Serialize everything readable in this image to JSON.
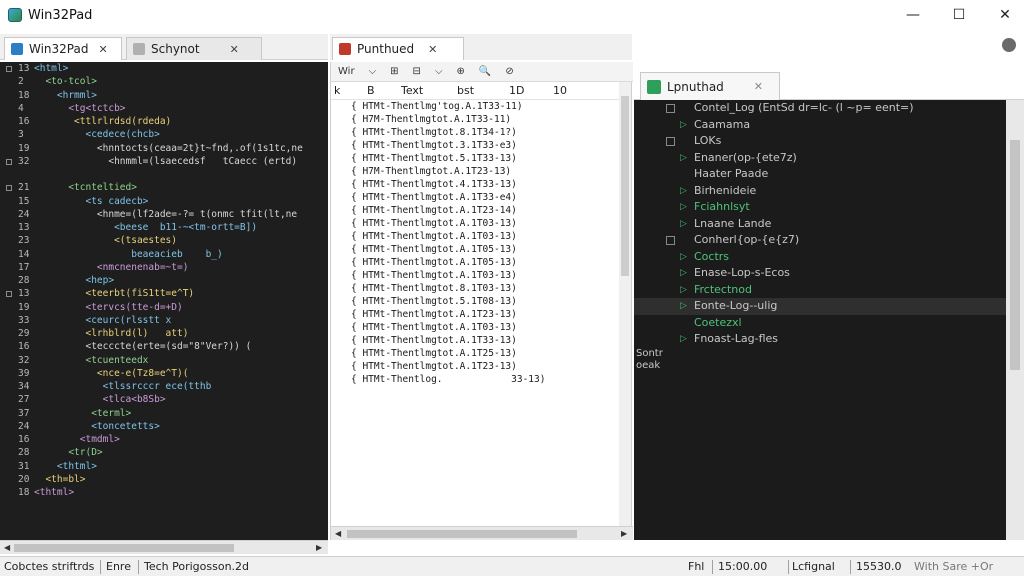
{
  "window": {
    "title": "Win32Pad"
  },
  "tabs_left": [
    {
      "label": "Win32Pad",
      "close": "✕"
    },
    {
      "label": "Schynot",
      "close": "✕"
    }
  ],
  "tab_middle": {
    "label": "Punthued",
    "close": "✕"
  },
  "tab_right": {
    "label": "Lpnuthad",
    "close": "✕"
  },
  "editor": {
    "line_numbers": [
      "13",
      "2",
      "18",
      "4",
      "16",
      "3",
      "19",
      "32",
      "",
      "21",
      "15",
      "24",
      "13",
      "23",
      "14",
      "17",
      "28",
      "13",
      "19",
      "33",
      "29",
      "16",
      "32",
      "39",
      "34",
      "27",
      "37",
      "24",
      "16",
      "28",
      "31",
      "20",
      "18"
    ],
    "lines": [
      "<html>",
      "  <to-tcol>",
      "    <hrmml>",
      "      <tg<tctcb>",
      "       <ttlrlrdsd(rdeda)",
      "         <cedece(chcb>",
      "           <hnntocts(ceaa=2t}t~fnd,.of(1s1tc,ne",
      "             <hnmml=(lsaecedsf   tCaecc (ertd)",
      "",
      "      <tcnteltied>",
      "         <ts cadecb>",
      "           <hnme=(lf2ade=-?= t(onmc tfit(lt,ne",
      "              <beese  b11-~<tm-ortt=B])",
      "              <(tsaestes)",
      "                 beaeacieb    b_)",
      "           <nmcnenenab=~t=)",
      "         <hep>",
      "         <teerbt(fiS1tt=e^T)",
      "         <tervcs(tte-d=+D)",
      "         <ceurc(rlsstt x",
      "         <lrhblrd(l)   att)",
      "         <tecccte(erte=(sd=\"8\"Ver?)) (",
      "         <tcuenteedx",
      "           <nce-e(Tz8=e^T)(",
      "            <tlssrcccr ece(tthb",
      "            <tlca<b8Sb>",
      "          <terml>",
      "          <toncetetts>",
      "        <tmdml>",
      "      <tr(D>",
      "    <thtml>",
      "  <th=bl>",
      "<thtml>"
    ]
  },
  "middle": {
    "toolbar": [
      "Wir",
      "⌵",
      "⊞",
      "⊟",
      "⌵",
      "⊕",
      "🔍",
      "⊘"
    ],
    "headers": [
      "k",
      "B",
      "Text",
      "bst",
      "1D",
      "10"
    ],
    "rows": [
      "{ HTMt-Thentlmg'tog.A.1T33-11)",
      "{ H7M-Thentlmgtot.A.1T33-11)",
      "{ HTMt-Thentlmgtot.8.1T34-1?)",
      "{ HTMt-Thentlmgtot.3.1T33-e3)",
      "{ HTMt-Thentlmgtot.5.1T33-13)",
      "{ H7M-Thentlmgtot.A.1T23-13)",
      "{ HTMt-Thentlmgtot.4.1T33-13)",
      "{ HTMt-Thentlmgtot.A.1T33-e4)",
      "{ HTMt-Thentlmgtot.A.1T23-14)",
      "{ HTMt-Thentlmgtot.A.1T03-13)",
      "{ HTMt-Thentlmgtot.A.1T03-13)",
      "{ HTMt-Thentlmgtot.A.1T05-13)",
      "{ HTMt-Thentlmgtot.A.1T05-13)",
      "{ HTMt-Thentlmgtot.A.1T03-13)",
      "{ HTMt-Thentlmgtot.8.1T03-13)",
      "{ HTMt-Thentlmgtot.5.1T08-13)",
      "{ HTMt-Thentlmgtot.A.1T23-13)",
      "{ HTMt-Thentlmgtot.A.1T03-13)",
      "{ HTMt-Thentlmgtot.A.1T33-13)",
      "{ HTMt-Thentlmgtot.A.1T25-13)",
      "{ HTMt-Thentlmgtot.A.1T23-13)",
      "{ HTMt-Thentlog.            33-13)"
    ]
  },
  "right": {
    "tree": [
      {
        "label": "Contel_Log (EntSd dr=lc- (l ~p= eent=)",
        "sq": true,
        "tri": false,
        "style": "plain"
      },
      {
        "label": "Caamama",
        "sq": false,
        "tri": true,
        "style": "plain"
      },
      {
        "label": "LOKs",
        "sq": true,
        "tri": false,
        "style": "plain"
      },
      {
        "label": "Enaner(op-{ete7z)",
        "sq": false,
        "tri": true,
        "style": "plain"
      },
      {
        "label": "Haater Paade",
        "sq": false,
        "tri": false,
        "style": "plain"
      },
      {
        "label": "Birhenideie",
        "sq": false,
        "tri": true,
        "style": "plain"
      },
      {
        "label": "Fciahnlsyt",
        "sq": false,
        "tri": true,
        "style": "green"
      },
      {
        "label": "Lnaane Lande",
        "sq": false,
        "tri": true,
        "style": "plain"
      },
      {
        "label": "Conherl{op-{e{z7)",
        "sq": true,
        "tri": false,
        "style": "plain"
      },
      {
        "label": "Coctrs",
        "sq": false,
        "tri": true,
        "style": "green"
      },
      {
        "label": "Enase-Lop-s-Ecos",
        "sq": false,
        "tri": true,
        "style": "plain"
      },
      {
        "label": "Frctectnod",
        "sq": false,
        "tri": true,
        "style": "green"
      },
      {
        "label": "Eonte-Log--ulig",
        "sq": false,
        "tri": true,
        "style": "sel"
      },
      {
        "label": "Coetezxl",
        "sq": false,
        "tri": false,
        "style": "green"
      },
      {
        "label": "Fnoast-Lag-fles",
        "sq": false,
        "tri": true,
        "style": "plain"
      }
    ],
    "side_text": [
      "Sontr",
      "oeak"
    ]
  },
  "status": {
    "items": [
      "Cobctes striftrds",
      "Enre",
      "Tech Porigosson.2d",
      "Fhl",
      "15:00.00",
      "Lcfignal",
      "15530.0",
      "With Sare +Or"
    ]
  }
}
